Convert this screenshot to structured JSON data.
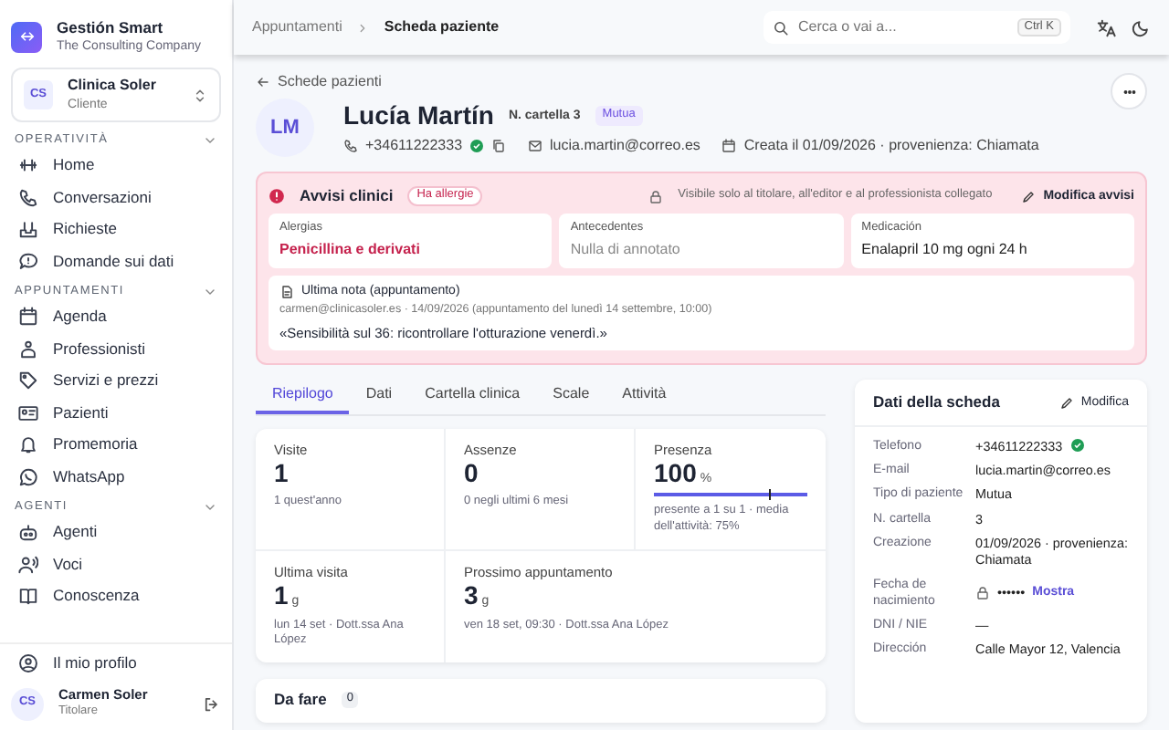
{
  "app": {
    "name": "Gestión Smart",
    "company": "The Consulting Company"
  },
  "org_switcher": {
    "initials": "CS",
    "name": "Clinica Soler",
    "role": "Cliente"
  },
  "nav_sections": [
    {
      "title": "OPERATIVITÀ",
      "expanded": true,
      "items": [
        "Home",
        "Conversazioni",
        "Richieste",
        "Domande sui dati"
      ]
    },
    {
      "title": "APPUNTAMENTI",
      "expanded": true,
      "items": [
        "Agenda",
        "Professionisti",
        "Servizi e prezzi",
        "Pazienti",
        "Promemoria",
        "WhatsApp"
      ]
    },
    {
      "title": "AGENTI",
      "expanded": true,
      "items": [
        "Agenti",
        "Voci",
        "Conoscenza"
      ]
    }
  ],
  "profile_link": "Il mio profilo",
  "user": {
    "initials": "CS",
    "name": "Carmen Soler",
    "role": "Titolare"
  },
  "breadcrumbs": [
    "Appuntamenti",
    "Scheda paziente"
  ],
  "search": {
    "placeholder": "Cerca o vai a...",
    "shortcut": "Ctrl K"
  },
  "back_link": "Schede pazienti",
  "patient": {
    "initials": "LM",
    "name": "Lucía Martín",
    "record": "N. cartella 3",
    "tag": "Mutua",
    "phone": "+34611222333",
    "verified": true,
    "email": "lucia.martin@correo.es",
    "created": "Creata il 01/09/2026 · provenienza: Chiamata"
  },
  "alerts": {
    "title": "Avvisi clinici",
    "badge": "Ha allergie",
    "visibility": "Visibile solo al titolare, all'editor e al professionista collegato",
    "edit": "Modifica avvisi",
    "fields": [
      {
        "label": "Alergias",
        "value": "Penicillina e derivati",
        "kind": "danger"
      },
      {
        "label": "Antecedentes",
        "value": "Nulla di annotato",
        "kind": "empty"
      },
      {
        "label": "Medicación",
        "value": "Enalapril 10 mg ogni 24 h",
        "kind": "normal"
      }
    ],
    "note": {
      "title": "Ultima nota (appuntamento)",
      "meta": "carmen@clinicasoler.es · 14/09/2026 (appuntamento del lunedì 14 settembre, 10:00)",
      "text": "«Sensibilità sul 36: ricontrollare l'otturazione venerdì.»"
    }
  },
  "tabs": [
    {
      "label": "Riepilogo",
      "selected": true
    },
    {
      "label": "Dati",
      "selected": false
    },
    {
      "label": "Cartella clinica",
      "selected": false
    },
    {
      "label": "Scale",
      "selected": false
    },
    {
      "label": "Attività",
      "selected": false
    }
  ],
  "stats": [
    {
      "label": "Visite",
      "value": "1",
      "sub": "1 quest'anno"
    },
    {
      "label": "Assenze",
      "value": "0",
      "sub": "0 negli ultimi 6 mesi"
    },
    {
      "label": "Presenza",
      "value": "100",
      "unit": "%",
      "sub": "presente a 1 su 1 · media dell'attività: 75%",
      "meter": {
        "level": 1.0,
        "average": {
          "level": 0.75
        }
      }
    },
    {
      "label": "Ultima visita",
      "value": "1",
      "unit": "g",
      "sub": "lun 14 set · Dott.ssa Ana López"
    },
    {
      "label": "Prossimo appuntamento",
      "value": "3",
      "unit": "g",
      "sub": "ven 18 set, 09:30 · Dott.ssa Ana López"
    }
  ],
  "todo": {
    "title": "Da fare",
    "count": "0"
  },
  "details": {
    "title": "Dati della scheda",
    "edit": "Modifica",
    "rows": [
      {
        "label": "Telefono",
        "value": "+34611222333",
        "verified": true
      },
      {
        "label": "E-mail",
        "value": "lucia.martin@correo.es"
      },
      {
        "label": "Tipo di paziente",
        "value": "Mutua"
      },
      {
        "label": "N. cartella",
        "value": "3"
      },
      {
        "label": "Creazione",
        "value": "01/09/2026 · provenienza: Chiamata"
      },
      {
        "label": "Fecha de nacimiento",
        "value": "••••••",
        "kind": "masked",
        "action": "Mostra"
      },
      {
        "label": "DNI / NIE",
        "value": "—"
      },
      {
        "label": "Dirección",
        "value": "Calle Mayor 12, Valencia"
      }
    ]
  }
}
